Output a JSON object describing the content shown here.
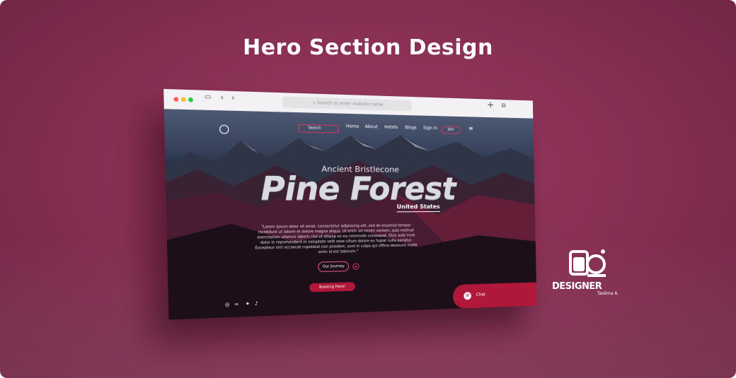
{
  "page": {
    "headline": "Hero Section Design"
  },
  "browser": {
    "url_placeholder": "Search or enter website name",
    "traffic_lights": [
      "#ff5f57",
      "#febc2e",
      "#28c840"
    ]
  },
  "site": {
    "nav": {
      "search_label": "Search",
      "items": [
        "Home",
        "About",
        "Hotels",
        "Blogs",
        "Sign In"
      ],
      "join_label": "Join"
    },
    "hero": {
      "pretitle": "Ancient Bristlecone",
      "title": "Pine Forest",
      "location": "United States",
      "quote": "\"Lorem ipsum dolor sit amet, consectetur adipiscing elit, sed do eiusmod tempor incididunt ut labore et dolore magna aliqua. Ut enim ad minim veniam, quis nostrud exercitation ullamco laboris nisi ut aliquip ex ea commodo consequat. Duis aute irure dolor in reprehenderit in voluptate velit esse cillum dolore eu fugiat nulla pariatur. Excepteur sint occaecat cupidatat non proident, sunt in culpa qui officia deserunt mollit anim id est laborum.\"",
      "journey_label": "Our Journey",
      "booking_label": "Booking Here!"
    },
    "chat_label": "Chat",
    "social_icons": [
      "instagram-icon",
      "meta-icon",
      "twitter-icon",
      "tiktok-icon"
    ]
  },
  "brand": {
    "wordmark": "DESIGNER",
    "author": "Taslima A."
  },
  "colors": {
    "accent": "#b0183a",
    "background": "#8a3055"
  }
}
